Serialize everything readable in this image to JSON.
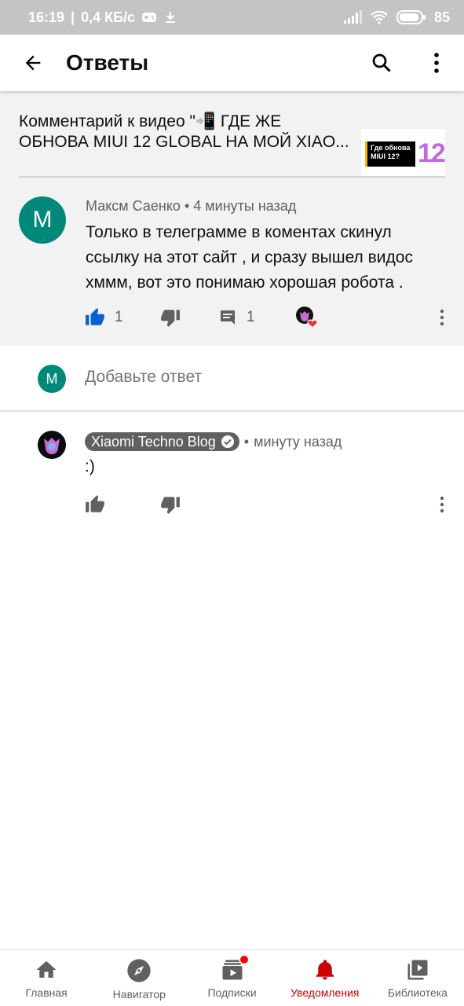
{
  "status_bar": {
    "time": "16:19",
    "net_speed": "0,4 КБ/с",
    "battery": "85"
  },
  "header": {
    "title": "Ответы"
  },
  "video": {
    "line1": "Комментарий к видео \"📲 ГДЕ ЖЕ",
    "line2": "ОБНОВА MIUI 12 GLOBAL НА МОЙ XIAO...",
    "thumb_text": "Где обнова MIUI 12?",
    "thumb_number": "12"
  },
  "comment": {
    "avatar_letter": "М",
    "author": "Максм Саенко",
    "separator": "•",
    "time": "4 минуты назад",
    "text": "Только в телеграмме в коментах скинул ссылку на этот сайт , и сразу вышел видос хммм, вот это понимаю хорошая робота .",
    "likes": "1",
    "replies": "1"
  },
  "add_reply": {
    "avatar_letter": "М",
    "placeholder": "Добавьте ответ"
  },
  "reply": {
    "author": "Xiaomi Techno Blog",
    "separator": "•",
    "time": "минуту назад",
    "text": ":)"
  },
  "nav": {
    "items": [
      {
        "label": "Главная"
      },
      {
        "label": "Навигатор"
      },
      {
        "label": "Подписки"
      },
      {
        "label": "Уведомления"
      },
      {
        "label": "Библиотека"
      }
    ],
    "active": "Уведомления",
    "active_color": "#cc0000"
  },
  "colors": {
    "like_active": "#065fd4",
    "avatar_bg": "#00897b",
    "notification_dot": "#ff0000"
  }
}
